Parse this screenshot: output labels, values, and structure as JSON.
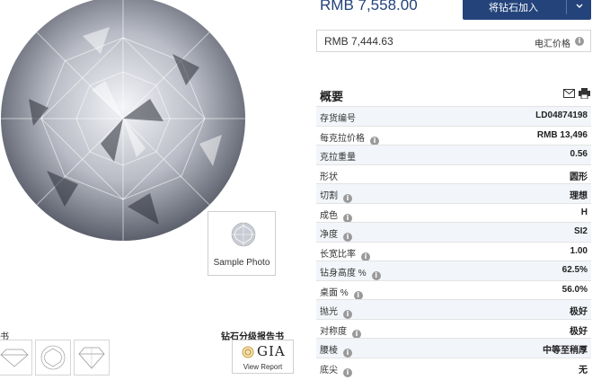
{
  "diamond": {
    "sample_caption": "Sample Photo"
  },
  "left": {
    "edge_label": "书",
    "report_label": "钻石分级报告书",
    "gia_logo_text": "GIA",
    "gia_link": "View Report"
  },
  "price": {
    "main": "RMB 7,558.00",
    "add_button": "将钻石加入",
    "wire_value": "RMB 7,444.63",
    "wire_label": "电汇价格"
  },
  "overview": {
    "title": "概要",
    "rows": [
      {
        "label": "存货编号",
        "value": "LD04874198",
        "info": false
      },
      {
        "label": "每克拉价格",
        "value": "RMB 13,496",
        "info": true
      },
      {
        "label": "克拉重量",
        "value": "0.56",
        "info": false
      },
      {
        "label": "形状",
        "value": "圆形",
        "info": false
      },
      {
        "label": "切割",
        "value": "理想",
        "info": true
      },
      {
        "label": "成色",
        "value": "H",
        "info": true
      },
      {
        "label": "净度",
        "value": "SI2",
        "info": true
      },
      {
        "label": "长宽比率",
        "value": "1.00",
        "info": true
      },
      {
        "label": "钻身高度 %",
        "value": "62.5%",
        "info": true
      },
      {
        "label": "桌面 %",
        "value": "56.0%",
        "info": true
      },
      {
        "label": "抛光",
        "value": "极好",
        "info": true
      },
      {
        "label": "对称度",
        "value": "极好",
        "info": true
      },
      {
        "label": "腰棱",
        "value": "中等至稍厚",
        "info": true
      },
      {
        "label": "底尖",
        "value": "无",
        "info": true
      }
    ]
  },
  "colors": {
    "primary": "#23437a",
    "row_shade": "#f2f6fa"
  }
}
